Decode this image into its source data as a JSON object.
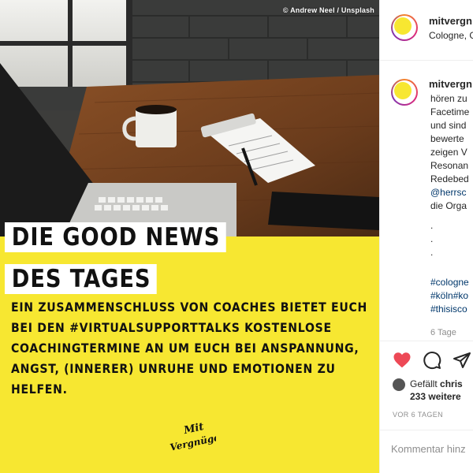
{
  "post": {
    "photo_credit": "© Andrew Neel / Unsplash",
    "headline_line1": "DIE GOOD NEWS",
    "headline_line2": "DES TAGES",
    "body_lines": [
      "EIN ZUSAMMENSCHLUSS VON COACHES BIETET EUCH",
      "BEI DEN #VIRTUALSUPPORTTALKS KOSTENLOSE",
      "COACHINGTERMINE AN UM EUCH BEI ANSPANNUNG,",
      "ANGST, (INNERER) UNRUHE UND EMOTIONEN ZU",
      "HELFEN."
    ],
    "brand_logo_text": "Mit Vergnügen",
    "accent_color": "#f7e731"
  },
  "sidebar": {
    "header": {
      "username": "mitvergn",
      "location": "Cologne, G"
    },
    "caption": {
      "username": "mitvergn",
      "lines": [
        "hören zu",
        "Facetime",
        "und sind",
        "bewerte",
        "zeigen V",
        "Resonan",
        "Redebed"
      ],
      "mention": "@herrsc",
      "after_mention": "die Orga",
      "dots": [
        ".",
        ".",
        "."
      ],
      "hashtags": [
        "#cologne",
        "#köln#ko",
        "#thisisco"
      ],
      "time_ago": "6 Tage"
    },
    "actions": {
      "like_icon": "heart-icon",
      "comment_icon": "comment-icon",
      "share_icon": "share-icon",
      "like_color": "#ed4956"
    },
    "likes": {
      "prefix": "Gefällt ",
      "liker": "chris",
      "count_text": "233 weitere"
    },
    "post_date": "VOR 6 TAGEN",
    "comment_placeholder": "Kommentar hinz"
  }
}
